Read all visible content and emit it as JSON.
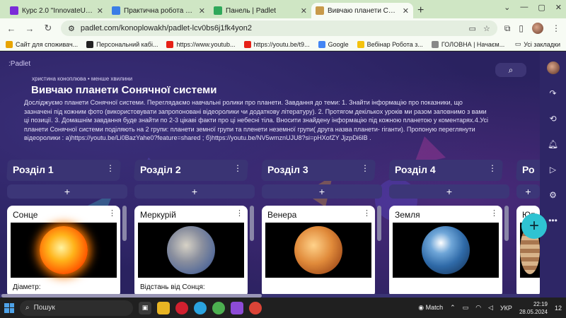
{
  "browser": {
    "tabs": [
      {
        "title": "Курс 2.0 \"InnovateU: розвиток",
        "favicon_color": "#7a2bd8"
      },
      {
        "title": "Практична робота №1 - Goog",
        "favicon_color": "#3a7de6"
      },
      {
        "title": "Панель | Padlet",
        "favicon_color": "#2fa85a"
      },
      {
        "title": "Вивчаю планети Сонячної сис",
        "favicon_color": "#c89a4a"
      }
    ],
    "url": "padlet.com/konoplowakh/padlet-lcv0bs6j1fk4yon2",
    "bookmarks": [
      {
        "label": "Сайт для споживач...",
        "color": "#e8a400"
      },
      {
        "label": "Персональний кабі...",
        "color": "#222222"
      },
      {
        "label": "https://www.youtub...",
        "color": "#e62117"
      },
      {
        "label": "https://youtu.be/t9...",
        "color": "#e62117"
      },
      {
        "label": "Google",
        "color": "#4285f4"
      },
      {
        "label": "Вебінар Робота з...",
        "color": "#f4c20d"
      },
      {
        "label": "ГОЛОВНА | Начаєм...",
        "color": "#888888"
      }
    ],
    "all_bookmarks": "Усі закладки"
  },
  "padlet": {
    "logo": ":Padlet",
    "author": "христина коноплюва  •  менше хвилини",
    "title": "Вивчаю планети Сонячної системи",
    "description": "Досліджуємо планети Сонячної системи. Переглядаємо навчальні ролики про планети. Завдання до теми: 1. Знайти інформацію про показники, що зазначені під кожним фото (використовувати запропоновані відеоролики чи  додаткову літературу). 2.  Протягом декількох уроків ми разом заповнимо з вами ці позиції. 3. Домашнім завдання буде знайти по 2-3 цікаві факти про ці небесні тіла.  Вносити знайдену інформацію під кожною планетою у коментарях.4.Усі планети Сонячної системи поділяють на 2 групи: планети земної групи та пленети неземної групи( друга назва планети- гіганти). Пропоную переглянути відеоролики : а)https://youtu.be/Li0BazYahe0?feature=shared ; б)https://youtu.be/NV5wmznUJU8?si=pHXofZY JjzpDi6lB .",
    "sections": [
      {
        "label": "Розділ 1",
        "card_title": "Сонце",
        "card_text": "Діаметр:",
        "planet": "sun"
      },
      {
        "label": "Розділ 2",
        "card_title": "Меркурій",
        "card_text": "Відстань від Сонця:",
        "planet": "mercury"
      },
      {
        "label": "Розділ 3",
        "card_title": "Венера",
        "card_text": "",
        "planet": "venus"
      },
      {
        "label": "Розділ 4",
        "card_title": "Земля",
        "card_text": "",
        "planet": "earth"
      },
      {
        "label": "Ро",
        "card_title": "Юп",
        "card_text": "",
        "planet": "jupiter"
      }
    ],
    "add_symbol": "+"
  },
  "taskbar": {
    "search_label": "Пошук",
    "weather": "Match",
    "language": "УКР",
    "time": "22:19",
    "date": "28.05.2024",
    "notifications": "12"
  }
}
